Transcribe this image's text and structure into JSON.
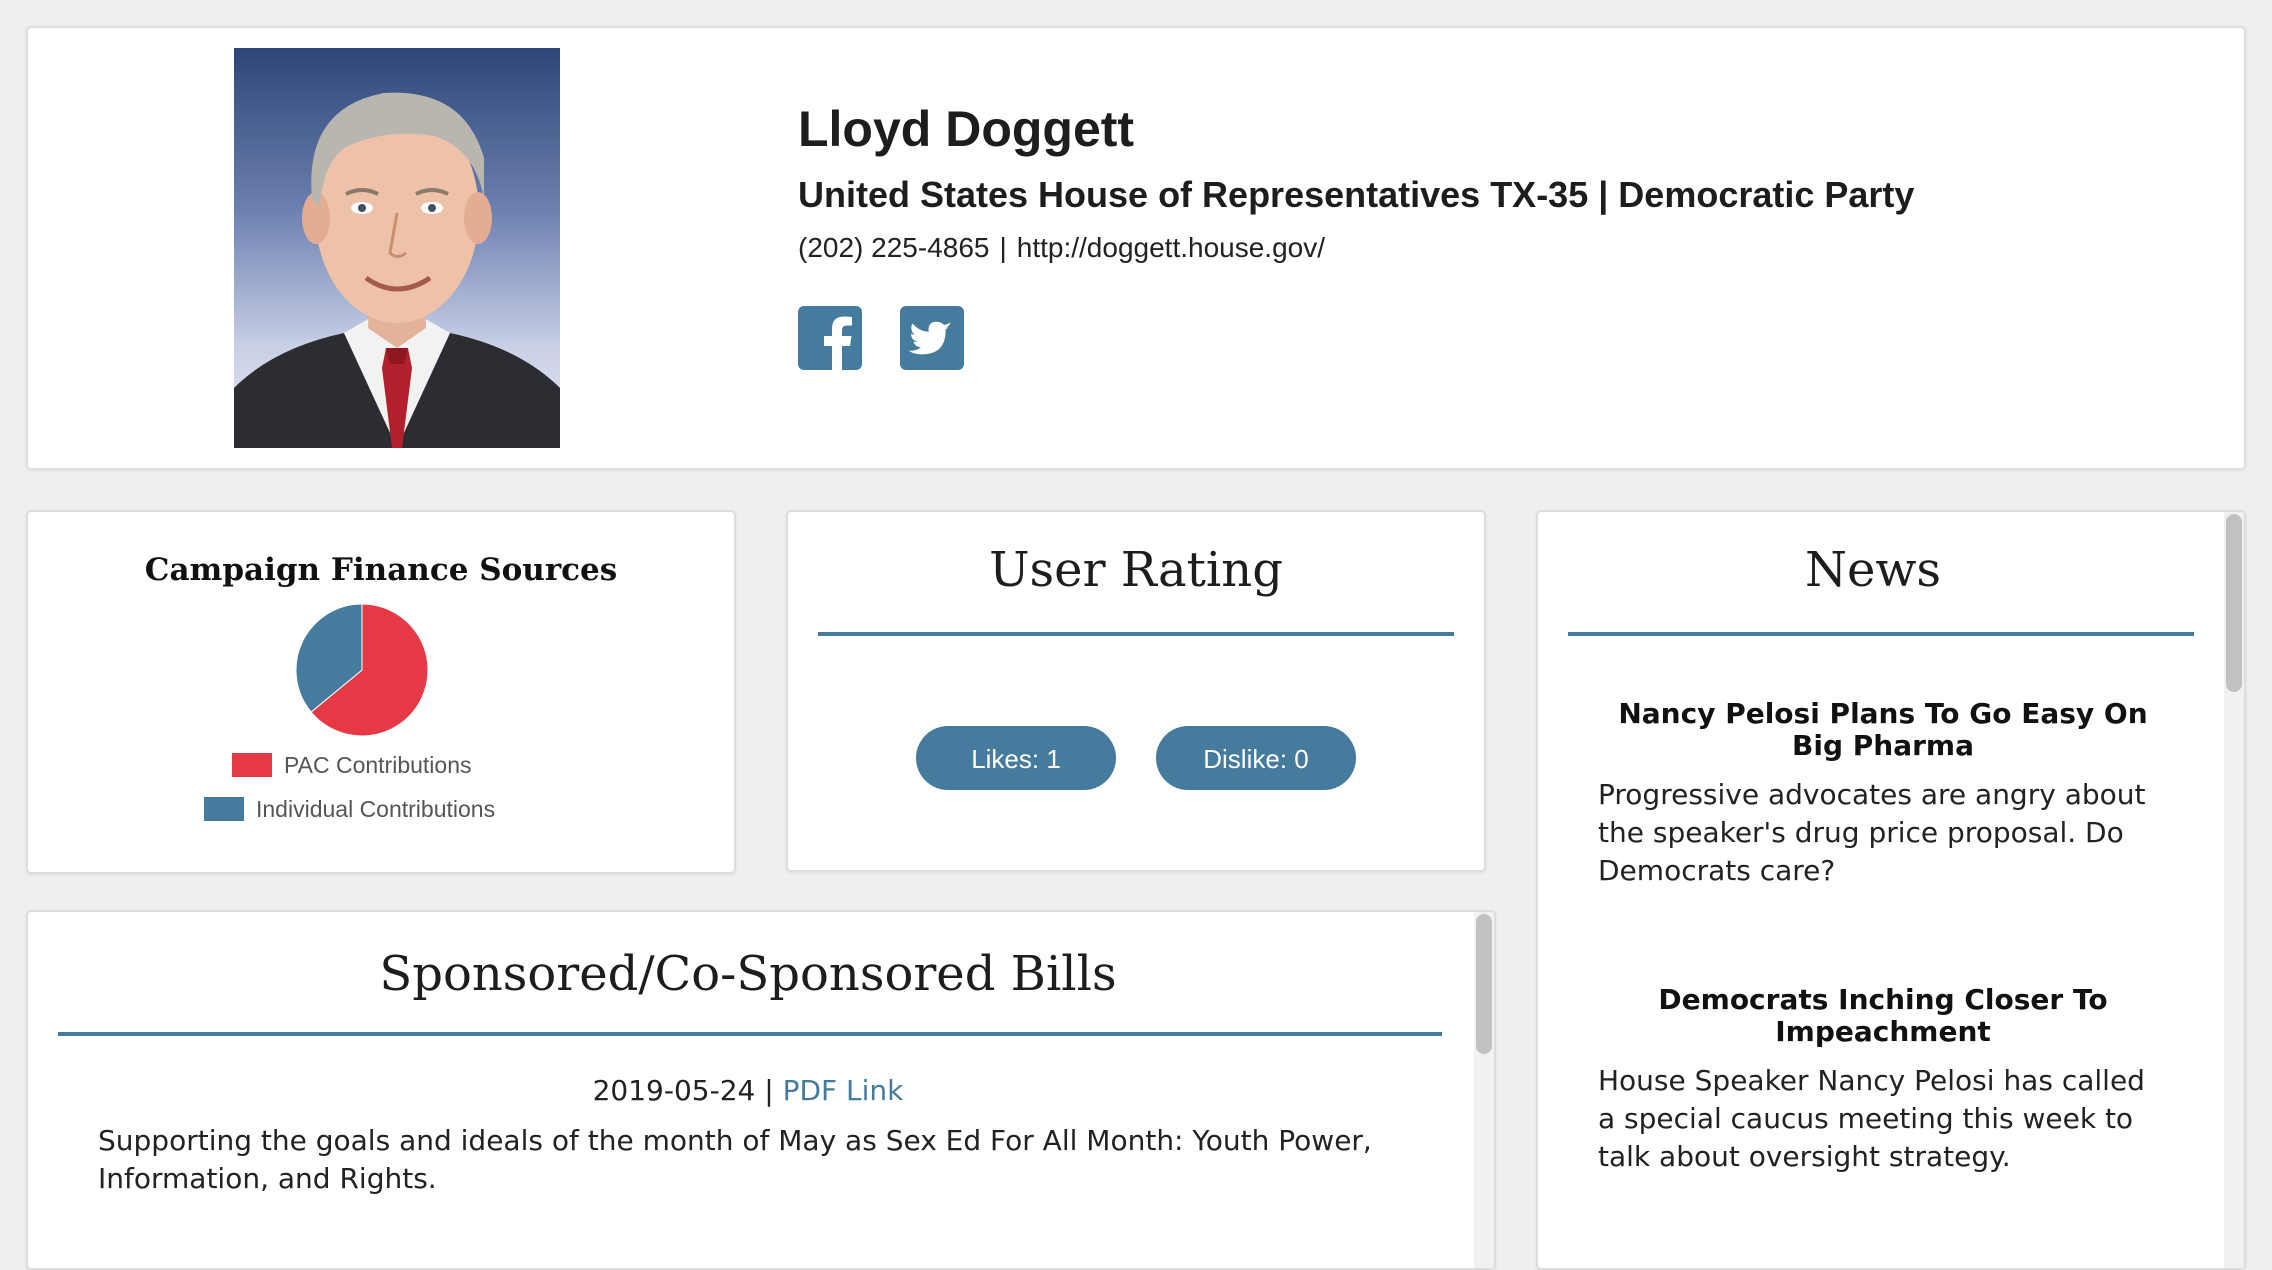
{
  "profile": {
    "name": "Lloyd Doggett",
    "office": "United States House of Representatives TX-35 | Democratic Party",
    "phone": "(202) 225-4865",
    "separator": "|",
    "website": "http://doggett.house.gov/",
    "social": {
      "facebook_icon": "facebook-icon",
      "twitter_icon": "twitter-icon"
    }
  },
  "finance": {
    "title": "Campaign Finance Sources",
    "legend": {
      "pac": "PAC Contributions",
      "individual": "Individual Contributions"
    }
  },
  "chart_data": {
    "type": "pie",
    "title": "Campaign Finance Sources",
    "labels": [
      "PAC Contributions",
      "Individual Contributions"
    ],
    "values": [
      64,
      36
    ],
    "colors": [
      "#e63946",
      "#457b9d"
    ],
    "legend": "bottom"
  },
  "rating": {
    "title": "User Rating",
    "likes_label": "Likes: 1",
    "dislike_label": "Dislike: 0"
  },
  "news": {
    "title": "News",
    "items": [
      {
        "headline": "Nancy Pelosi Plans To Go Easy On Big Pharma",
        "summary": "Progressive advocates are angry about the speaker's drug price proposal. Do Democrats care?"
      },
      {
        "headline": "Democrats Inching Closer To Impeachment",
        "summary": "House Speaker Nancy Pelosi has called a special caucus meeting this week to talk about oversight strategy."
      }
    ]
  },
  "bills": {
    "title": "Sponsored/Co-Sponsored Bills",
    "items": [
      {
        "date": "2019-05-24",
        "separator": "|",
        "link_label": "PDF Link",
        "description": "Supporting the goals and ideals of the month of May as Sex Ed For All Month: Youth Power, Information, and Rights."
      }
    ]
  },
  "colors": {
    "accent": "#457b9d",
    "pac": "#e63946",
    "background": "#efefef"
  }
}
